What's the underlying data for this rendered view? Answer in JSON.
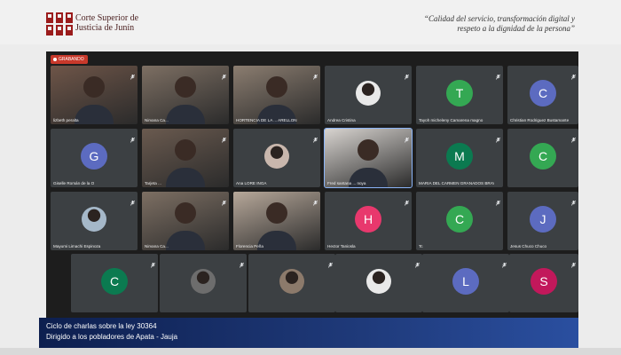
{
  "header": {
    "org_line1": "Corte Superior de",
    "org_line2": "Justicia de Junín",
    "slogan_line1": "“Calidad del servicio, transformación digital y",
    "slogan_line2": "respeto a la dignidad de la persona”"
  },
  "recording": {
    "label": "GRABANDO",
    "color": "#c8392b"
  },
  "participants": [
    {
      "name": "lizbeth peralta",
      "kind": "video",
      "tone": "#6e5548"
    },
    {
      "name": "Nirvana Ca...",
      "kind": "video",
      "tone": "#7d6f63"
    },
    {
      "name": "HORTENCIA DE LA ... ARELLON",
      "kind": "video",
      "tone": "#8b7d70"
    },
    {
      "name": "Andrea Cristina",
      "kind": "photo",
      "tone": "#e9e9e9"
    },
    {
      "name": "Tayoh micheleny Camarena magno",
      "kind": "avatar",
      "letter": "T",
      "color": "#34a853"
    },
    {
      "name": "Christian Rodriguez Bustamante",
      "kind": "avatar",
      "letter": "C",
      "color": "#5c6bc0"
    },
    {
      "name": "Giselle Román de la O",
      "kind": "avatar",
      "letter": "G",
      "color": "#5c6bc0"
    },
    {
      "name": "Tarjeta ...",
      "kind": "video",
      "tone": "#6a5a4f"
    },
    {
      "name": "Ana LORE INGA",
      "kind": "photo",
      "tone": "#c9b7ad"
    },
    {
      "name": "Fred santana ... noya",
      "kind": "video",
      "tone": "#d8d4d0"
    },
    {
      "name": "MARIA DEL CARMEN GRANADOS BRAVO",
      "kind": "avatar",
      "letter": "M",
      "color": "#0b7a50"
    },
    {
      "name": "",
      "kind": "avatar",
      "letter": "C",
      "color": "#34a853"
    },
    {
      "name": "Mayumi Limachi Espinoza",
      "kind": "photo",
      "tone": "#a5b8c9"
    },
    {
      "name": "Nirvana Ca...",
      "kind": "video",
      "tone": "#7d6f63"
    },
    {
      "name": "Florencia Peña",
      "kind": "video",
      "tone": "#b7a89a"
    },
    {
      "name": "Hector Taniosla",
      "kind": "avatar",
      "letter": "H",
      "color": "#e8386d"
    },
    {
      "name": "Tc",
      "kind": "avatar",
      "letter": "C",
      "color": "#34a853"
    },
    {
      "name": "Jesus Chuco Chuco",
      "kind": "avatar",
      "letter": "J",
      "color": "#5c6bc0"
    },
    {
      "name": "",
      "kind": "avatar",
      "letter": "C",
      "color": "#0b7a50"
    },
    {
      "name": "",
      "kind": "photo",
      "tone": "#6d6d6d"
    },
    {
      "name": "",
      "kind": "photo",
      "tone": "#8c7a6b"
    },
    {
      "name": "",
      "kind": "photo",
      "tone": "#e9e9e9"
    },
    {
      "name": "",
      "kind": "avatar",
      "letter": "L",
      "color": "#5c6bc0"
    },
    {
      "name": "",
      "kind": "avatar",
      "letter": "S",
      "color": "#c2185b"
    }
  ],
  "banner": {
    "line1": "Ciclo de charlas sobre la ley 30364",
    "line2": "Dirigido a los pobladores de Apata - Jauja"
  }
}
